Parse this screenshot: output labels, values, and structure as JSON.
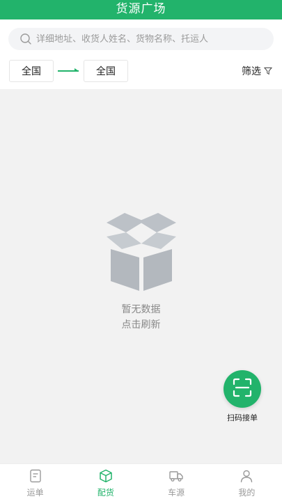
{
  "header": {
    "title": "货源广场"
  },
  "search": {
    "placeholder": "详细地址、收货人姓名、货物名称、托运人"
  },
  "route": {
    "from_label": "全国",
    "to_label": "全国"
  },
  "filter": {
    "label": "筛选"
  },
  "empty": {
    "title": "暂无数据",
    "refresh": "点击刷新"
  },
  "scan": {
    "label": "扫码接单"
  },
  "tabs": [
    {
      "label": "运单",
      "icon": "document-icon"
    },
    {
      "label": "配货",
      "icon": "box-icon",
      "active": true
    },
    {
      "label": "车源",
      "icon": "truck-icon"
    },
    {
      "label": "我的",
      "icon": "user-icon"
    }
  ],
  "colors": {
    "primary": "#22b36b",
    "inactive": "#999999",
    "background": "#f2f2f2"
  }
}
